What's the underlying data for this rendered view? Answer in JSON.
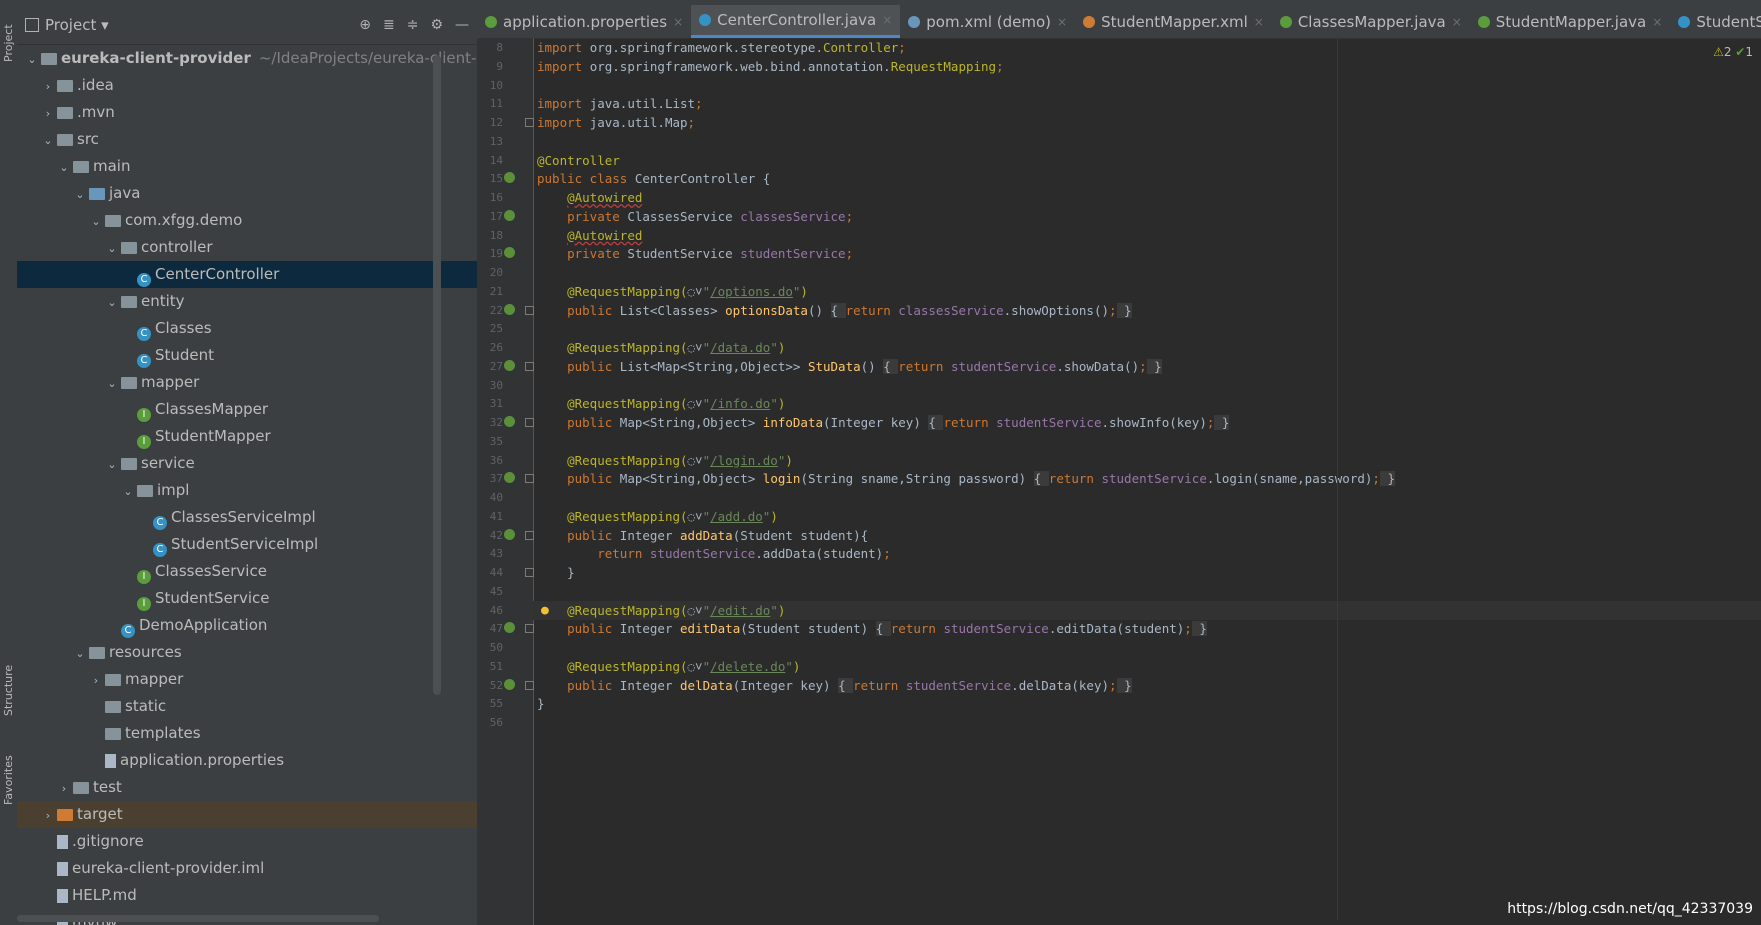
{
  "panel": {
    "title": "Project"
  },
  "side_tabs": {
    "project": "Project",
    "structure": "Structure",
    "favorites": "Favorites"
  },
  "tree": [
    {
      "depth": 0,
      "chev": "open",
      "icon": "module-folder",
      "label": "eureka-client-provider",
      "hint": "~/IdeaProjects/eureka-client-provi",
      "bold": true
    },
    {
      "depth": 1,
      "chev": "closed",
      "icon": "folder",
      "label": ".idea"
    },
    {
      "depth": 1,
      "chev": "closed",
      "icon": "folder",
      "label": ".mvn"
    },
    {
      "depth": 1,
      "chev": "open",
      "icon": "folder",
      "label": "src"
    },
    {
      "depth": 2,
      "chev": "open",
      "icon": "folder",
      "label": "main"
    },
    {
      "depth": 3,
      "chev": "open",
      "icon": "folder-blue",
      "label": "java"
    },
    {
      "depth": 4,
      "chev": "open",
      "icon": "package",
      "label": "com.xfgg.demo"
    },
    {
      "depth": 5,
      "chev": "open",
      "icon": "package",
      "label": "controller"
    },
    {
      "depth": 6,
      "chev": "",
      "icon": "class",
      "label": "CenterController",
      "selected": true
    },
    {
      "depth": 5,
      "chev": "open",
      "icon": "package",
      "label": "entity"
    },
    {
      "depth": 6,
      "chev": "",
      "icon": "class",
      "label": "Classes"
    },
    {
      "depth": 6,
      "chev": "",
      "icon": "class",
      "label": "Student"
    },
    {
      "depth": 5,
      "chev": "open",
      "icon": "package",
      "label": "mapper"
    },
    {
      "depth": 6,
      "chev": "",
      "icon": "interface",
      "label": "ClassesMapper"
    },
    {
      "depth": 6,
      "chev": "",
      "icon": "interface",
      "label": "StudentMapper"
    },
    {
      "depth": 5,
      "chev": "open",
      "icon": "package",
      "label": "service"
    },
    {
      "depth": 6,
      "chev": "open",
      "icon": "package",
      "label": "impl"
    },
    {
      "depth": 7,
      "chev": "",
      "icon": "class",
      "label": "ClassesServiceImpl"
    },
    {
      "depth": 7,
      "chev": "",
      "icon": "class",
      "label": "StudentServiceImpl"
    },
    {
      "depth": 6,
      "chev": "",
      "icon": "interface",
      "label": "ClassesService"
    },
    {
      "depth": 6,
      "chev": "",
      "icon": "interface",
      "label": "StudentService"
    },
    {
      "depth": 5,
      "chev": "",
      "icon": "class",
      "label": "DemoApplication"
    },
    {
      "depth": 3,
      "chev": "open",
      "icon": "folder-res",
      "label": "resources"
    },
    {
      "depth": 4,
      "chev": "closed",
      "icon": "folder",
      "label": "mapper"
    },
    {
      "depth": 4,
      "chev": "",
      "icon": "folder",
      "label": "static"
    },
    {
      "depth": 4,
      "chev": "",
      "icon": "folder",
      "label": "templates"
    },
    {
      "depth": 4,
      "chev": "",
      "icon": "file",
      "label": "application.properties"
    },
    {
      "depth": 2,
      "chev": "closed",
      "icon": "folder",
      "label": "test"
    },
    {
      "depth": 1,
      "chev": "closed",
      "icon": "folder-orange",
      "label": "target",
      "target": true
    },
    {
      "depth": 1,
      "chev": "",
      "icon": "file",
      "label": ".gitignore"
    },
    {
      "depth": 1,
      "chev": "",
      "icon": "file",
      "label": "eureka-client-provider.iml"
    },
    {
      "depth": 1,
      "chev": "",
      "icon": "file",
      "label": "HELP.md"
    },
    {
      "depth": 1,
      "chev": "",
      "icon": "file",
      "label": "mvnw"
    }
  ],
  "tabs": [
    {
      "label": "application.properties",
      "icon": "properties-icon",
      "color": "#5b9d3c",
      "active": false
    },
    {
      "label": "CenterController.java",
      "icon": "class-icon",
      "color": "#3592c4",
      "active": true
    },
    {
      "label": "pom.xml (demo)",
      "icon": "maven-icon",
      "color": "#6897bb",
      "active": false
    },
    {
      "label": "StudentMapper.xml",
      "icon": "xml-icon",
      "color": "#d07b34",
      "active": false
    },
    {
      "label": "ClassesMapper.java",
      "icon": "interface-icon",
      "color": "#5b9d3c",
      "active": false
    },
    {
      "label": "StudentMapper.java",
      "icon": "interface-icon",
      "color": "#5b9d3c",
      "active": false
    },
    {
      "label": "StudentServiceIm",
      "icon": "class-icon",
      "color": "#3592c4",
      "active": false
    }
  ],
  "inspection": {
    "warnings": "2",
    "ok": "1"
  },
  "code_lines": [
    {
      "n": "8",
      "caret": false,
      "mark": false,
      "fold": false,
      "segs": [
        [
          "kw",
          "import "
        ],
        [
          "txt",
          "org.springframework.stereotype."
        ],
        [
          "ann",
          "Controller"
        ],
        [
          "kw",
          ";"
        ]
      ]
    },
    {
      "n": "9",
      "caret": false,
      "mark": false,
      "fold": false,
      "segs": [
        [
          "kw",
          "import "
        ],
        [
          "txt",
          "org.springframework.web.bind.annotation."
        ],
        [
          "ann",
          "RequestMapping"
        ],
        [
          "kw",
          ";"
        ]
      ]
    },
    {
      "n": "10",
      "caret": false,
      "mark": false,
      "fold": false,
      "segs": []
    },
    {
      "n": "11",
      "caret": false,
      "mark": false,
      "fold": false,
      "segs": [
        [
          "kw",
          "import "
        ],
        [
          "txt",
          "java.util.List"
        ],
        [
          "kw",
          ";"
        ]
      ]
    },
    {
      "n": "12",
      "caret": false,
      "mark": false,
      "fold": true,
      "segs": [
        [
          "kw",
          "import "
        ],
        [
          "txt",
          "java.util.Map"
        ],
        [
          "kw",
          ";"
        ]
      ]
    },
    {
      "n": "13",
      "caret": false,
      "mark": false,
      "fold": false,
      "segs": []
    },
    {
      "n": "14",
      "caret": false,
      "mark": false,
      "fold": false,
      "segs": [
        [
          "ann",
          "@Controller"
        ]
      ]
    },
    {
      "n": "15",
      "caret": false,
      "mark": true,
      "fold": false,
      "segs": [
        [
          "kw",
          "public class "
        ],
        [
          "txt",
          "CenterController {"
        ]
      ]
    },
    {
      "n": "16",
      "caret": false,
      "mark": false,
      "fold": false,
      "segs": [
        [
          "txt",
          "    "
        ],
        [
          "ann ulwarn",
          "@Autowired"
        ]
      ]
    },
    {
      "n": "17",
      "caret": false,
      "mark": true,
      "fold": false,
      "segs": [
        [
          "txt",
          "    "
        ],
        [
          "kw",
          "private "
        ],
        [
          "txt",
          "ClassesService "
        ],
        [
          "fld",
          "classesService"
        ],
        [
          "kw",
          ";"
        ]
      ]
    },
    {
      "n": "18",
      "caret": false,
      "mark": false,
      "fold": false,
      "segs": [
        [
          "txt",
          "    "
        ],
        [
          "ann ulwarn",
          "@Autowired"
        ]
      ]
    },
    {
      "n": "19",
      "caret": false,
      "mark": true,
      "fold": false,
      "segs": [
        [
          "txt",
          "    "
        ],
        [
          "kw",
          "private "
        ],
        [
          "txt",
          "StudentService "
        ],
        [
          "fld",
          "studentService"
        ],
        [
          "kw",
          ";"
        ]
      ]
    },
    {
      "n": "20",
      "caret": false,
      "mark": false,
      "fold": false,
      "segs": []
    },
    {
      "n": "21",
      "caret": false,
      "mark": false,
      "fold": false,
      "segs": [
        [
          "txt",
          "    "
        ],
        [
          "ann",
          "@RequestMapping("
        ],
        [
          "txt",
          "◌˅"
        ],
        [
          "str",
          "\""
        ],
        [
          "url",
          "/options.do"
        ],
        [
          "str",
          "\""
        ],
        [
          "ann",
          ")"
        ]
      ]
    },
    {
      "n": "22",
      "caret": false,
      "mark": true,
      "fold": true,
      "segs": [
        [
          "txt",
          "    "
        ],
        [
          "kw",
          "public "
        ],
        [
          "txt",
          "List<Classes> "
        ],
        [
          "fn",
          "optionsData"
        ],
        [
          "txt",
          "() "
        ],
        [
          "fbox",
          "{ "
        ],
        [
          "kw",
          "return "
        ],
        [
          "fld",
          "classesService"
        ],
        [
          "txt",
          ".showOptions()"
        ],
        [
          "kw",
          ";"
        ],
        [
          "fbox",
          " }"
        ]
      ]
    },
    {
      "n": "25",
      "caret": false,
      "mark": false,
      "fold": false,
      "segs": []
    },
    {
      "n": "26",
      "caret": false,
      "mark": false,
      "fold": false,
      "segs": [
        [
          "txt",
          "    "
        ],
        [
          "ann",
          "@RequestMapping("
        ],
        [
          "txt",
          "◌˅"
        ],
        [
          "str",
          "\""
        ],
        [
          "url",
          "/data.do"
        ],
        [
          "str",
          "\""
        ],
        [
          "ann",
          ")"
        ]
      ]
    },
    {
      "n": "27",
      "caret": false,
      "mark": true,
      "fold": true,
      "segs": [
        [
          "txt",
          "    "
        ],
        [
          "kw",
          "public "
        ],
        [
          "txt",
          "List<Map<String,Object>> "
        ],
        [
          "fn",
          "StuData"
        ],
        [
          "txt",
          "() "
        ],
        [
          "fbox",
          "{ "
        ],
        [
          "kw",
          "return "
        ],
        [
          "fld",
          "studentService"
        ],
        [
          "txt",
          ".showData()"
        ],
        [
          "kw",
          ";"
        ],
        [
          "fbox",
          " }"
        ]
      ]
    },
    {
      "n": "30",
      "caret": false,
      "mark": false,
      "fold": false,
      "segs": []
    },
    {
      "n": "31",
      "caret": false,
      "mark": false,
      "fold": false,
      "segs": [
        [
          "txt",
          "    "
        ],
        [
          "ann",
          "@RequestMapping("
        ],
        [
          "txt",
          "◌˅"
        ],
        [
          "str",
          "\""
        ],
        [
          "url",
          "/info.do"
        ],
        [
          "str",
          "\""
        ],
        [
          "ann",
          ")"
        ]
      ]
    },
    {
      "n": "32",
      "caret": false,
      "mark": true,
      "fold": true,
      "segs": [
        [
          "txt",
          "    "
        ],
        [
          "kw",
          "public "
        ],
        [
          "txt",
          "Map<String,Object> "
        ],
        [
          "fn",
          "infoData"
        ],
        [
          "txt",
          "(Integer key) "
        ],
        [
          "fbox",
          "{ "
        ],
        [
          "kw",
          "return "
        ],
        [
          "fld",
          "studentService"
        ],
        [
          "txt",
          ".showInfo(key)"
        ],
        [
          "kw",
          ";"
        ],
        [
          "fbox",
          " }"
        ]
      ]
    },
    {
      "n": "35",
      "caret": false,
      "mark": false,
      "fold": false,
      "segs": []
    },
    {
      "n": "36",
      "caret": false,
      "mark": false,
      "fold": false,
      "segs": [
        [
          "txt",
          "    "
        ],
        [
          "ann",
          "@RequestMapping("
        ],
        [
          "txt",
          "◌˅"
        ],
        [
          "str",
          "\""
        ],
        [
          "url",
          "/login.do"
        ],
        [
          "str",
          "\""
        ],
        [
          "ann",
          ")"
        ]
      ]
    },
    {
      "n": "37",
      "caret": false,
      "mark": true,
      "fold": true,
      "segs": [
        [
          "txt",
          "    "
        ],
        [
          "kw",
          "public "
        ],
        [
          "txt",
          "Map<String,Object> "
        ],
        [
          "fn",
          "login"
        ],
        [
          "txt",
          "(String sname,String password) "
        ],
        [
          "fbox",
          "{ "
        ],
        [
          "kw",
          "return "
        ],
        [
          "fld",
          "studentService"
        ],
        [
          "txt",
          ".login(sname,password)"
        ],
        [
          "kw",
          ";"
        ],
        [
          "fbox",
          " }"
        ]
      ]
    },
    {
      "n": "40",
      "caret": false,
      "mark": false,
      "fold": false,
      "segs": []
    },
    {
      "n": "41",
      "caret": false,
      "mark": false,
      "fold": false,
      "segs": [
        [
          "txt",
          "    "
        ],
        [
          "ann",
          "@RequestMapping("
        ],
        [
          "txt",
          "◌˅"
        ],
        [
          "str",
          "\""
        ],
        [
          "url",
          "/add.do"
        ],
        [
          "str",
          "\""
        ],
        [
          "ann",
          ")"
        ]
      ]
    },
    {
      "n": "42",
      "caret": false,
      "mark": true,
      "fold": true,
      "segs": [
        [
          "txt",
          "    "
        ],
        [
          "kw",
          "public "
        ],
        [
          "txt",
          "Integer "
        ],
        [
          "fn",
          "addData"
        ],
        [
          "txt",
          "(Student student){"
        ]
      ]
    },
    {
      "n": "43",
      "caret": false,
      "mark": false,
      "fold": false,
      "segs": [
        [
          "txt",
          "        "
        ],
        [
          "kw",
          "return "
        ],
        [
          "fld",
          "studentService"
        ],
        [
          "txt",
          ".addData(student)"
        ],
        [
          "kw",
          ";"
        ]
      ]
    },
    {
      "n": "44",
      "caret": false,
      "mark": false,
      "fold": true,
      "segs": [
        [
          "txt",
          "    }"
        ]
      ]
    },
    {
      "n": "45",
      "caret": false,
      "mark": false,
      "fold": false,
      "segs": []
    },
    {
      "n": "46",
      "caret": true,
      "mark": false,
      "fold": false,
      "bulb": true,
      "segs": [
        [
          "txt",
          "    "
        ],
        [
          "ann",
          "@RequestMapping("
        ],
        [
          "txt",
          "◌˅"
        ],
        [
          "str",
          "\""
        ],
        [
          "url",
          "/edit.do"
        ],
        [
          "str",
          "\""
        ],
        [
          "ann",
          ")"
        ]
      ]
    },
    {
      "n": "47",
      "caret": false,
      "mark": true,
      "fold": true,
      "segs": [
        [
          "txt",
          "    "
        ],
        [
          "kw",
          "public "
        ],
        [
          "txt",
          "Integer "
        ],
        [
          "fn",
          "editData"
        ],
        [
          "txt",
          "(Student student) "
        ],
        [
          "fbox",
          "{ "
        ],
        [
          "kw",
          "return "
        ],
        [
          "fld",
          "studentService"
        ],
        [
          "txt",
          ".editData(student)"
        ],
        [
          "kw",
          ";"
        ],
        [
          "fbox",
          " }"
        ]
      ]
    },
    {
      "n": "50",
      "caret": false,
      "mark": false,
      "fold": false,
      "segs": []
    },
    {
      "n": "51",
      "caret": false,
      "mark": false,
      "fold": false,
      "segs": [
        [
          "txt",
          "    "
        ],
        [
          "ann",
          "@RequestMapping("
        ],
        [
          "txt",
          "◌˅"
        ],
        [
          "str",
          "\""
        ],
        [
          "url",
          "/delete.do"
        ],
        [
          "str",
          "\""
        ],
        [
          "ann",
          ")"
        ]
      ]
    },
    {
      "n": "52",
      "caret": false,
      "mark": true,
      "fold": true,
      "segs": [
        [
          "txt",
          "    "
        ],
        [
          "kw",
          "public "
        ],
        [
          "txt",
          "Integer "
        ],
        [
          "fn",
          "delData"
        ],
        [
          "txt",
          "(Integer key) "
        ],
        [
          "fbox",
          "{ "
        ],
        [
          "kw",
          "return "
        ],
        [
          "fld",
          "studentService"
        ],
        [
          "txt",
          ".delData(key)"
        ],
        [
          "kw",
          ";"
        ],
        [
          "fbox",
          " }"
        ]
      ]
    },
    {
      "n": "55",
      "caret": false,
      "mark": false,
      "fold": false,
      "segs": [
        [
          "txt",
          "}"
        ]
      ]
    },
    {
      "n": "56",
      "caret": false,
      "mark": false,
      "fold": false,
      "segs": []
    }
  ],
  "watermark": "https://blog.csdn.net/qq_42337039"
}
